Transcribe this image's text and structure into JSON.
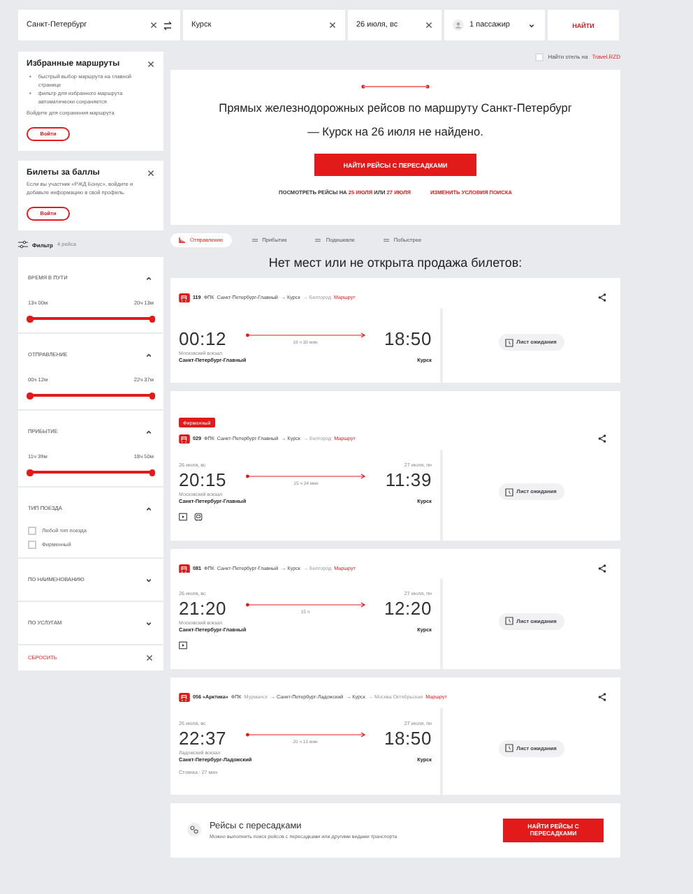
{
  "search": {
    "from": "Санкт-Петербург",
    "to": "Курск",
    "date": "26 июля, вс",
    "passengers": "1 пассажир",
    "button": "НАЙТИ"
  },
  "hotel": {
    "label": "Найти отель на",
    "link": "Travel.RZD",
    "checked": false
  },
  "promos": [
    {
      "title": "Избранные маршруты",
      "bullets": [
        {
          "marker": "•",
          "text": "быстрый выбор маршрута на главной странице"
        },
        {
          "marker": "•",
          "text": "фильтр для избранного маршрута автоматически сохраняется"
        }
      ],
      "text": "Войдите для сохранения маршрута",
      "button": "Войти"
    },
    {
      "title": "Билеты за баллы",
      "text": "Если вы участник «РЖД Бонус», войдите и добавьте информацию в свой профиль.",
      "button": "Войти"
    }
  ],
  "filter": {
    "label": "Фильтр",
    "count": "4 рейса",
    "sections": [
      {
        "kind": "range",
        "title": "ВРЕМЯ В ПУТИ",
        "expanded": true,
        "min": "13ч 00м",
        "max": "20ч 13м",
        "level": 1
      },
      {
        "kind": "range",
        "title": "ОТПРАВЛЕНИЕ",
        "expanded": true,
        "min": "00ч 12м",
        "max": "22ч 37м",
        "level": 1
      },
      {
        "kind": "range",
        "title": "ПРИБЫТИЕ",
        "expanded": true,
        "min": "11ч 39м",
        "max": "18ч 50м",
        "level": 1
      },
      {
        "kind": "checks",
        "title": "ТИП ПОЕЗДА",
        "expanded": true,
        "options": [
          {
            "label": "Любой тип поезда",
            "checked": false
          },
          {
            "label": "Фирменный",
            "checked": false
          }
        ]
      },
      {
        "title": "ПО НАИМЕНОВАНИЮ",
        "expanded": false
      },
      {
        "title": "ПО УСЛУГАМ",
        "expanded": false
      }
    ],
    "reset": "СБРОСИТЬ"
  },
  "notice": {
    "text": "Прямых железнодорожных рейсов по маршруту Санкт-Петербург — Курск на 26 июля не найдено.",
    "button": "НАЙТИ РЕЙСЫ С ПЕРЕСАДКАМИ",
    "view": "ПОСМОТРЕТЬ РЕЙСЫ НА",
    "date1": "25 ИЮЛЯ",
    "or": "ИЛИ",
    "date2": "27 ИЮЛЯ",
    "change": "ИЗМЕНИТЬ УСЛОВИЯ ПОИСКА"
  },
  "sort": [
    {
      "label": "Отправление",
      "selected": true
    },
    {
      "label": "Прибытие",
      "selected": false
    },
    {
      "label": "Подешевле",
      "selected": false
    },
    {
      "label": "Побыстрее",
      "selected": false
    }
  ],
  "heading": "Нет мест или не открыта продажа билетов:",
  "trains": [
    {
      "number": "119",
      "carrier": "ФПК",
      "stops": [
        {
          "name": "Санкт-Петербург-Главный",
          "in_trip": true
        },
        {
          "name": "→ Курск",
          "in_trip": true
        },
        {
          "name": "→ Белгород",
          "in_trip": false
        }
      ],
      "route_link": "Маршрут",
      "dep_time": "00:12",
      "arr_time": "18:50",
      "duration": "18 ч 38 мин",
      "dep_label": "Московский вокзал",
      "dep_station": "Санкт-Петербург-Главный",
      "arr_station": "Курск",
      "waitlist": "Лист ожидания"
    },
    {
      "badge": "Фирменный",
      "number": "029",
      "carrier": "ФПК",
      "stops": [
        {
          "name": "Санкт-Петербург-Главный",
          "in_trip": true
        },
        {
          "name": "→ Курск",
          "in_trip": true
        },
        {
          "name": "→ Белгород",
          "in_trip": false
        }
      ],
      "route_link": "Маршрут",
      "dep_date": "26 июля, вс",
      "arr_date": "27 июля, пн",
      "dep_time": "20:15",
      "arr_time": "11:39",
      "duration": "15 ч 24 мин",
      "dep_label": "Московский вокзал",
      "dep_station": "Санкт-Петербург-Главный",
      "arr_station": "Курск",
      "amenities": [
        {
          "kind": "video"
        },
        {
          "kind": "train"
        }
      ],
      "waitlist": "Лист ожидания"
    },
    {
      "number": "081",
      "carrier": "ФПК",
      "stops": [
        {
          "name": "Санкт-Петербург-Главный",
          "in_trip": true
        },
        {
          "name": "→ Курск",
          "in_trip": true
        },
        {
          "name": "→ Белгород",
          "in_trip": false
        }
      ],
      "route_link": "Маршрут",
      "dep_date": "26 июля, вс",
      "arr_date": "27 июля, пн",
      "dep_time": "21:20",
      "arr_time": "12:20",
      "duration": "15 ч",
      "dep_label": "Московский вокзал",
      "dep_station": "Санкт-Петербург-Главный",
      "arr_station": "Курск",
      "amenities": [
        {
          "kind": "video"
        }
      ],
      "waitlist": "Лист ожидания"
    },
    {
      "number": "056 «Арктика»",
      "carrier": "ФПК",
      "stops": [
        {
          "name": "Мурманск",
          "in_trip": false
        },
        {
          "name": "→ Санкт-Петербург-Ладожский",
          "in_trip": true
        },
        {
          "name": "→ Курск",
          "in_trip": true
        },
        {
          "name": "→ Москва Октябрьская",
          "in_trip": false
        }
      ],
      "route_link": "Маршрут",
      "dep_date": "26 июля, вс",
      "arr_date": "27 июля, пн",
      "dep_time": "22:37",
      "arr_time": "18:50",
      "duration": "20 ч 13 мин",
      "dep_label": "Ладожский вокзал",
      "dep_station": "Санкт-Петербург-Ладожский",
      "arr_station": "Курск",
      "stop": "Стоянка : 27 мин",
      "waitlist": "Лист ожидания"
    }
  ],
  "transfers": {
    "title": "Рейсы с пересадками",
    "text": "Можно выполнить поиск рейсов с пересадками или другими видами транспорта",
    "button": "НАЙТИ РЕЙСЫ С ПЕРЕСАДКАМИ"
  }
}
